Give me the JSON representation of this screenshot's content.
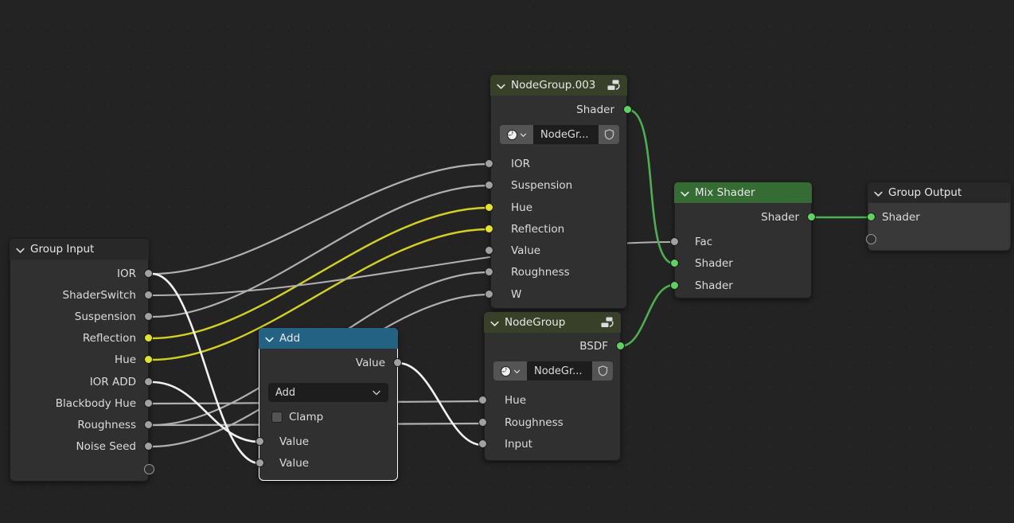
{
  "editor": {
    "name": "blender-shader-node-editor",
    "background_color": "#232323",
    "grid_dot_color": "#2e2e2e"
  },
  "palette": {
    "header_group": "#394029",
    "header_shader": "#346c34",
    "header_converter": "#246283",
    "header_interface": "#282828",
    "node_body": "#303030",
    "node_body_active": "#393939",
    "socket_gray": "#a1a1a1",
    "socket_yellow": "#e3e32f",
    "socket_green": "#5fd35f",
    "link_gray": "#b0b0b0",
    "link_yellow": "#d2d21e",
    "link_green": "#4caf50",
    "link_highlight": "#f2f2f2",
    "selected_outline": "#ffffff"
  },
  "nodes": {
    "group_input": {
      "title": "Group Input",
      "header_type": "iface",
      "icon": "collapse-chevron-icon",
      "outputs": [
        {
          "label": "IOR",
          "socket": "gray"
        },
        {
          "label": "ShaderSwitch",
          "socket": "gray"
        },
        {
          "label": "Suspension",
          "socket": "gray"
        },
        {
          "label": "Reflection",
          "socket": "yellow"
        },
        {
          "label": "Hue",
          "socket": "yellow"
        },
        {
          "label": "IOR ADD",
          "socket": "gray"
        },
        {
          "label": "Blackbody Hue",
          "socket": "gray"
        },
        {
          "label": "Roughness",
          "socket": "gray"
        },
        {
          "label": "Noise Seed",
          "socket": "gray"
        },
        {
          "label": "",
          "socket": "hollow"
        }
      ]
    },
    "nodegroup_003": {
      "title": "NodeGroup.003",
      "header_type": "group",
      "icon": "node-group-icon",
      "outputs": [
        {
          "label": "Shader",
          "socket": "green"
        }
      ],
      "datablock": {
        "browse_icon": "browse-id-icon",
        "chevron_icon": "chevron-down-icon",
        "name": "NodeGr...",
        "shield_icon": "fake-user-shield-icon"
      },
      "inputs": [
        {
          "label": "IOR",
          "socket": "gray"
        },
        {
          "label": "Suspension",
          "socket": "gray"
        },
        {
          "label": "Hue",
          "socket": "yellow"
        },
        {
          "label": "Reflection",
          "socket": "yellow"
        },
        {
          "label": "Value",
          "socket": "gray"
        },
        {
          "label": "Roughness",
          "socket": "gray"
        },
        {
          "label": "W",
          "socket": "gray"
        }
      ]
    },
    "nodegroup": {
      "title": "NodeGroup",
      "header_type": "group",
      "icon": "node-group-icon",
      "outputs": [
        {
          "label": "BSDF",
          "socket": "green"
        }
      ],
      "datablock": {
        "browse_icon": "browse-id-icon",
        "chevron_icon": "chevron-down-icon",
        "name": "NodeGr...",
        "shield_icon": "fake-user-shield-icon"
      },
      "inputs": [
        {
          "label": "Hue",
          "socket": "gray"
        },
        {
          "label": "Roughness",
          "socket": "gray"
        },
        {
          "label": "Input",
          "socket": "gray"
        }
      ]
    },
    "add": {
      "title": "Add",
      "header_type": "conv",
      "selected": true,
      "outputs": [
        {
          "label": "Value",
          "socket": "gray"
        }
      ],
      "operation_dropdown": {
        "value": "Add",
        "chevron_icon": "chevron-down-icon"
      },
      "clamp": {
        "label": "Clamp",
        "checked": false
      },
      "inputs": [
        {
          "label": "Value",
          "socket": "gray"
        },
        {
          "label": "Value",
          "socket": "gray"
        }
      ]
    },
    "mix_shader": {
      "title": "Mix Shader",
      "header_type": "shader",
      "outputs": [
        {
          "label": "Shader",
          "socket": "green"
        }
      ],
      "inputs": [
        {
          "label": "Fac",
          "socket": "gray"
        },
        {
          "label": "Shader",
          "socket": "green"
        },
        {
          "label": "Shader",
          "socket": "green"
        }
      ]
    },
    "group_output": {
      "title": "Group Output",
      "header_type": "iface",
      "active": true,
      "inputs": [
        {
          "label": "Shader",
          "socket": "green"
        },
        {
          "label": "",
          "socket": "hollow"
        }
      ]
    }
  },
  "links": [
    {
      "from": "group_input.IOR",
      "to": "nodegroup_003.IOR",
      "color": "gray"
    },
    {
      "from": "group_input.IOR",
      "to": "add.Value2",
      "color": "highlight"
    },
    {
      "from": "group_input.ShaderSwitch",
      "to": "mix_shader.Fac",
      "color": "gray"
    },
    {
      "from": "group_input.Suspension",
      "to": "nodegroup_003.Suspension",
      "color": "gray"
    },
    {
      "from": "group_input.Reflection",
      "to": "nodegroup_003.Hue",
      "color": "yellow"
    },
    {
      "from": "group_input.Hue",
      "to": "nodegroup_003.Reflection",
      "color": "yellow"
    },
    {
      "from": "group_input.IOR ADD",
      "to": "add.Value1",
      "color": "highlight"
    },
    {
      "from": "group_input.Blackbody Hue",
      "to": "nodegroup.Hue",
      "color": "gray"
    },
    {
      "from": "group_input.Roughness",
      "to": "nodegroup_003.Roughness",
      "color": "gray"
    },
    {
      "from": "group_input.Roughness",
      "to": "nodegroup.Roughness",
      "color": "gray"
    },
    {
      "from": "group_input.Noise Seed",
      "to": "nodegroup_003.W",
      "color": "gray"
    },
    {
      "from": "add.Value",
      "to": "nodegroup.Input",
      "color": "highlight"
    },
    {
      "from": "nodegroup_003.Shader",
      "to": "mix_shader.Shader1",
      "color": "green"
    },
    {
      "from": "nodegroup.BSDF",
      "to": "mix_shader.Shader2",
      "color": "green"
    },
    {
      "from": "mix_shader.Shader",
      "to": "group_output.Shader",
      "color": "green"
    }
  ]
}
